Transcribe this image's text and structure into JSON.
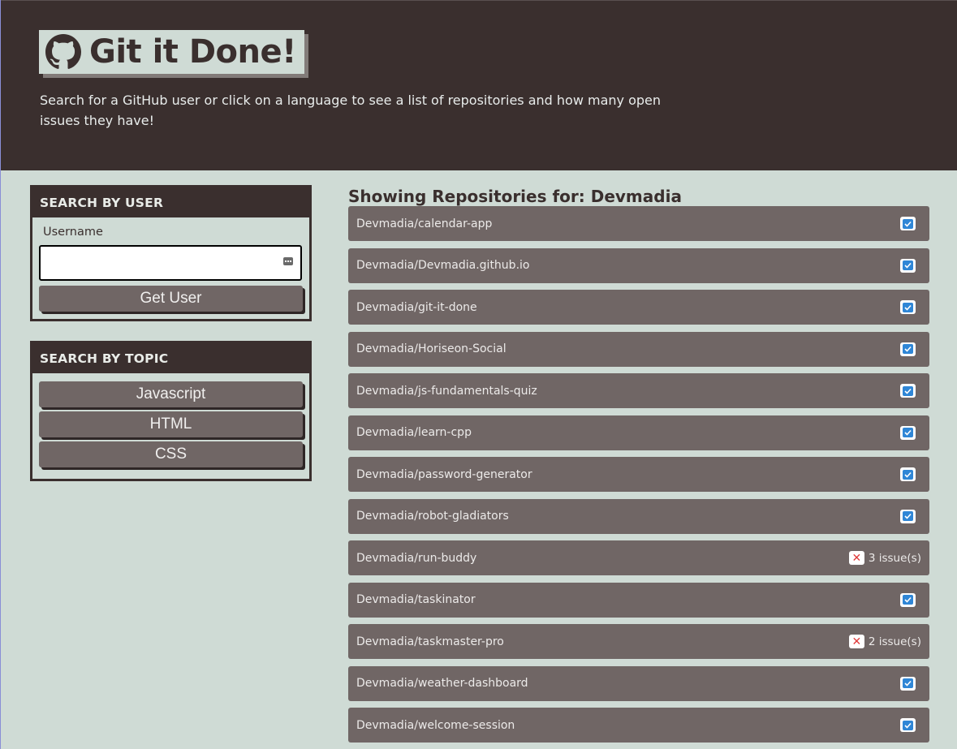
{
  "header": {
    "title": "Git it Done!",
    "subtitle": "Search for a GitHub user or click on a language to see a list of repositories and how many open issues they have!",
    "logo_icon": "github-icon"
  },
  "user_search": {
    "heading": "SEARCH BY USER",
    "label": "Username",
    "input_value": "",
    "button": "Get User"
  },
  "topic_search": {
    "heading": "SEARCH BY TOPIC",
    "topics": [
      "Javascript",
      "HTML",
      "CSS"
    ]
  },
  "repos": {
    "title": "Showing Repositories for: Devmadia",
    "items": [
      {
        "name": "Devmadia/calendar-app",
        "issues": ""
      },
      {
        "name": "Devmadia/Devmadia.github.io",
        "issues": ""
      },
      {
        "name": "Devmadia/git-it-done",
        "issues": ""
      },
      {
        "name": "Devmadia/Horiseon-Social",
        "issues": ""
      },
      {
        "name": "Devmadia/js-fundamentals-quiz",
        "issues": ""
      },
      {
        "name": "Devmadia/learn-cpp",
        "issues": ""
      },
      {
        "name": "Devmadia/password-generator",
        "issues": ""
      },
      {
        "name": "Devmadia/robot-gladiators",
        "issues": ""
      },
      {
        "name": "Devmadia/run-buddy",
        "issues": "3 issue(s)"
      },
      {
        "name": "Devmadia/taskinator",
        "issues": ""
      },
      {
        "name": "Devmadia/taskmaster-pro",
        "issues": "2 issue(s)"
      },
      {
        "name": "Devmadia/weather-dashboard",
        "issues": ""
      },
      {
        "name": "Devmadia/welcome-session",
        "issues": ""
      }
    ]
  },
  "colors": {
    "header_bg": "#3a2f2e",
    "page_bg": "#cfdbd5",
    "item_bg": "#706665",
    "check_blue": "#2f86d6",
    "issue_red": "#e03a3a"
  }
}
